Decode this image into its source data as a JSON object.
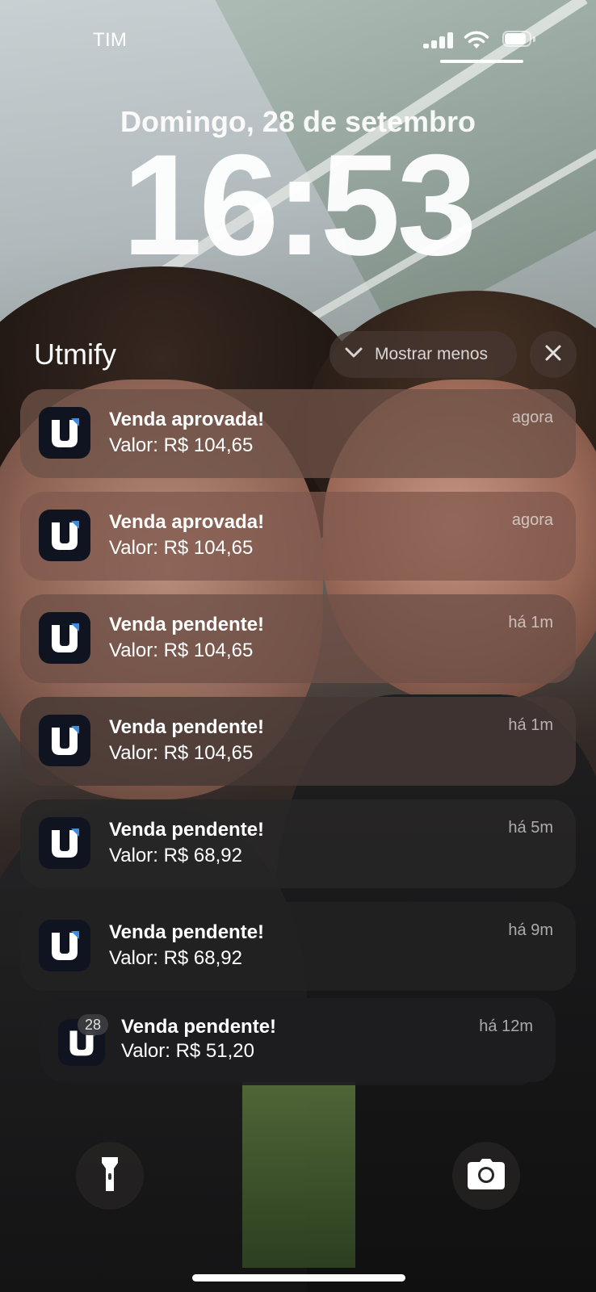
{
  "status_bar": {
    "carrier": "TIM",
    "battery_level": 0.85
  },
  "lock": {
    "date": "Domingo, 28 de setembro",
    "time": "16:53"
  },
  "group": {
    "app_name": "Utmify",
    "show_less_label": "Mostrar menos",
    "count_badge": "28"
  },
  "notifications": [
    {
      "title": "Venda aprovada!",
      "body": "Valor: R$ 104,65",
      "time": "agora"
    },
    {
      "title": "Venda aprovada!",
      "body": "Valor: R$ 104,65",
      "time": "agora"
    },
    {
      "title": "Venda pendente!",
      "body": "Valor: R$ 104,65",
      "time": "há 1m"
    },
    {
      "title": "Venda pendente!",
      "body": "Valor: R$ 104,65",
      "time": "há 1m"
    },
    {
      "title": "Venda pendente!",
      "body": "Valor: R$ 68,92",
      "time": "há 5m"
    },
    {
      "title": "Venda pendente!",
      "body": "Valor: R$ 68,92",
      "time": "há 9m"
    },
    {
      "title": "Venda pendente!",
      "body": "Valor: R$ 51,20",
      "time": "há 12m"
    }
  ],
  "icons": {
    "app": "utmify-u-logo-icon",
    "show_less": "chevron-down-icon",
    "close": "close-icon",
    "flashlight": "flashlight-icon",
    "camera": "camera-icon"
  },
  "colors": {
    "app_icon_bg": "#0f1420",
    "app_icon_accent": "#3b8de0"
  }
}
